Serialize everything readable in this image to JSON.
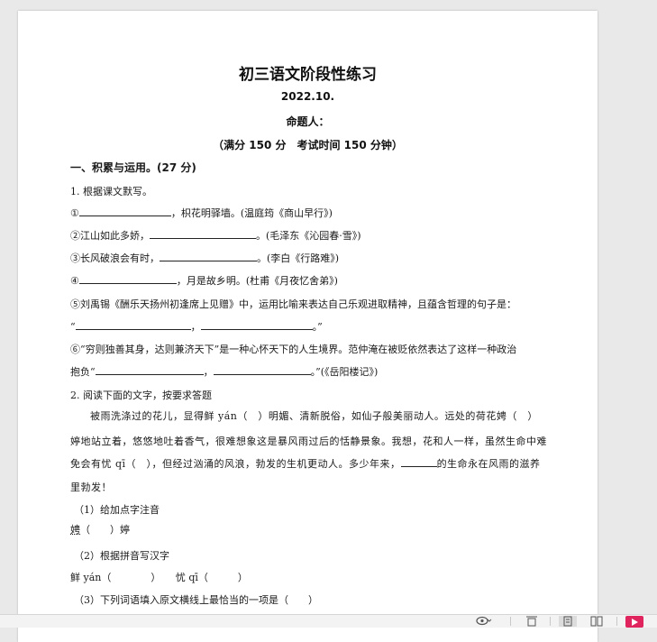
{
  "doc": {
    "title": "初三语文阶段性练习",
    "date": "2022.10.",
    "author_label": "命题人：",
    "score_time": "（满分 150 分　考试时间 150 分钟）",
    "section1": "一、积累与运用。(27 分)",
    "q1_title": "1. 根据课文默写。",
    "q1_items": [
      {
        "pre": "①",
        "post": "，枳花明驿墙。(温庭筠《商山早行》)"
      },
      {
        "pre": "②江山如此多娇，",
        "post": "。(毛泽东《沁园春·雪》)"
      },
      {
        "pre": "③长风破浪会有时，",
        "post": "。(李白《行路难》)"
      },
      {
        "pre": "④",
        "post": "，月是故乡明。(杜甫《月夜忆舍弟》)"
      }
    ],
    "q1_item5_text": "⑤刘禹锡《酬乐天扬州初逢席上见赠》中，运用比喻来表达自己乐观进取精神，且蕴含哲理的句子是：",
    "q1_item5_open": "“",
    "q1_item5_mid": "，",
    "q1_item5_close": "。”",
    "q1_item6_text": "⑥“穷则独善其身，达则兼济天下”是一种心怀天下的人生境界。范仲淹在被贬依然表达了这样一种政治",
    "q1_item6_pre": "抱负“",
    "q1_item6_mid": "，",
    "q1_item6_post": "。”(《岳阳楼记》)",
    "q2_title": "2. 阅读下面的文字，按要求答题",
    "passage_1": "被雨洗涤过的花儿，显得鲜 yán（　）明媚、清新脱俗，如仙子般美丽动人。远处的荷花娉（　）",
    "passage_2": "婷地站立着，悠悠地吐着香气，很难想象这是暴风雨过后的恬静景象。我想，花和人一样，虽然生命中难",
    "passage_3_pre": "免会有忧 qī（　），但经过汹涌的风浪，勃发的生机更动人。多少年来，",
    "passage_3_post": "的生命永在风雨的滋养",
    "passage_4": "里勃发！",
    "sub1": "（1）给加点字注音",
    "sub1_line_pre": "娉",
    "sub1_line_post": "（　　）婷",
    "sub2": "（2）根据拼音写汉字",
    "sub2_line": "鲜 yán（　　　　）　　忧 qī（　　　）",
    "sub3": "（3）下列词语填入原文横线上最恰当的一项是（　　）"
  },
  "toolbar": {
    "eye_icon": "eye-icon",
    "layout_icon": "single-page-icon",
    "page_icon": "page-view-icon",
    "double_icon": "double-page-icon",
    "play_icon": "play-icon",
    "accent": "#e0245e"
  }
}
